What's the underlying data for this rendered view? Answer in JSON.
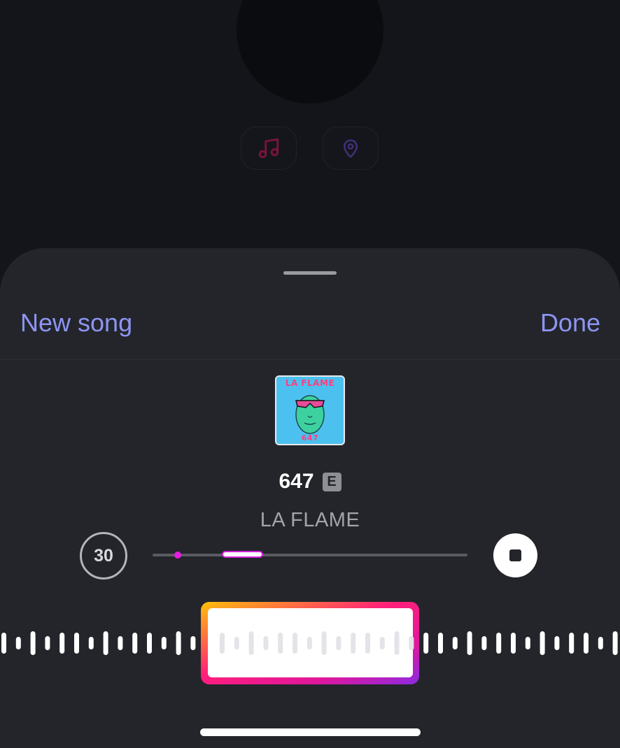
{
  "background": {
    "music_icon": "music-note-icon",
    "location_icon": "location-pin-icon",
    "colors": {
      "music": "#c2185b",
      "location": "#6a3fb5"
    }
  },
  "header": {
    "left_label": "New song",
    "right_label": "Done"
  },
  "song": {
    "album_art_text_top": "LA FLAME",
    "album_art_text_bottom": "647",
    "title": "647",
    "explicit_badge": "E",
    "artist": "LA FLAME"
  },
  "player": {
    "duration": "30",
    "stop_icon": "stop-icon",
    "selection_start": 0.22,
    "selection_end": 0.35,
    "marker_position": 0.08
  },
  "colors": {
    "accent": "#8c95f2",
    "gradient": [
      "#ffc107",
      "#ff1f7a",
      "#e0179c",
      "#8a2be2"
    ]
  }
}
